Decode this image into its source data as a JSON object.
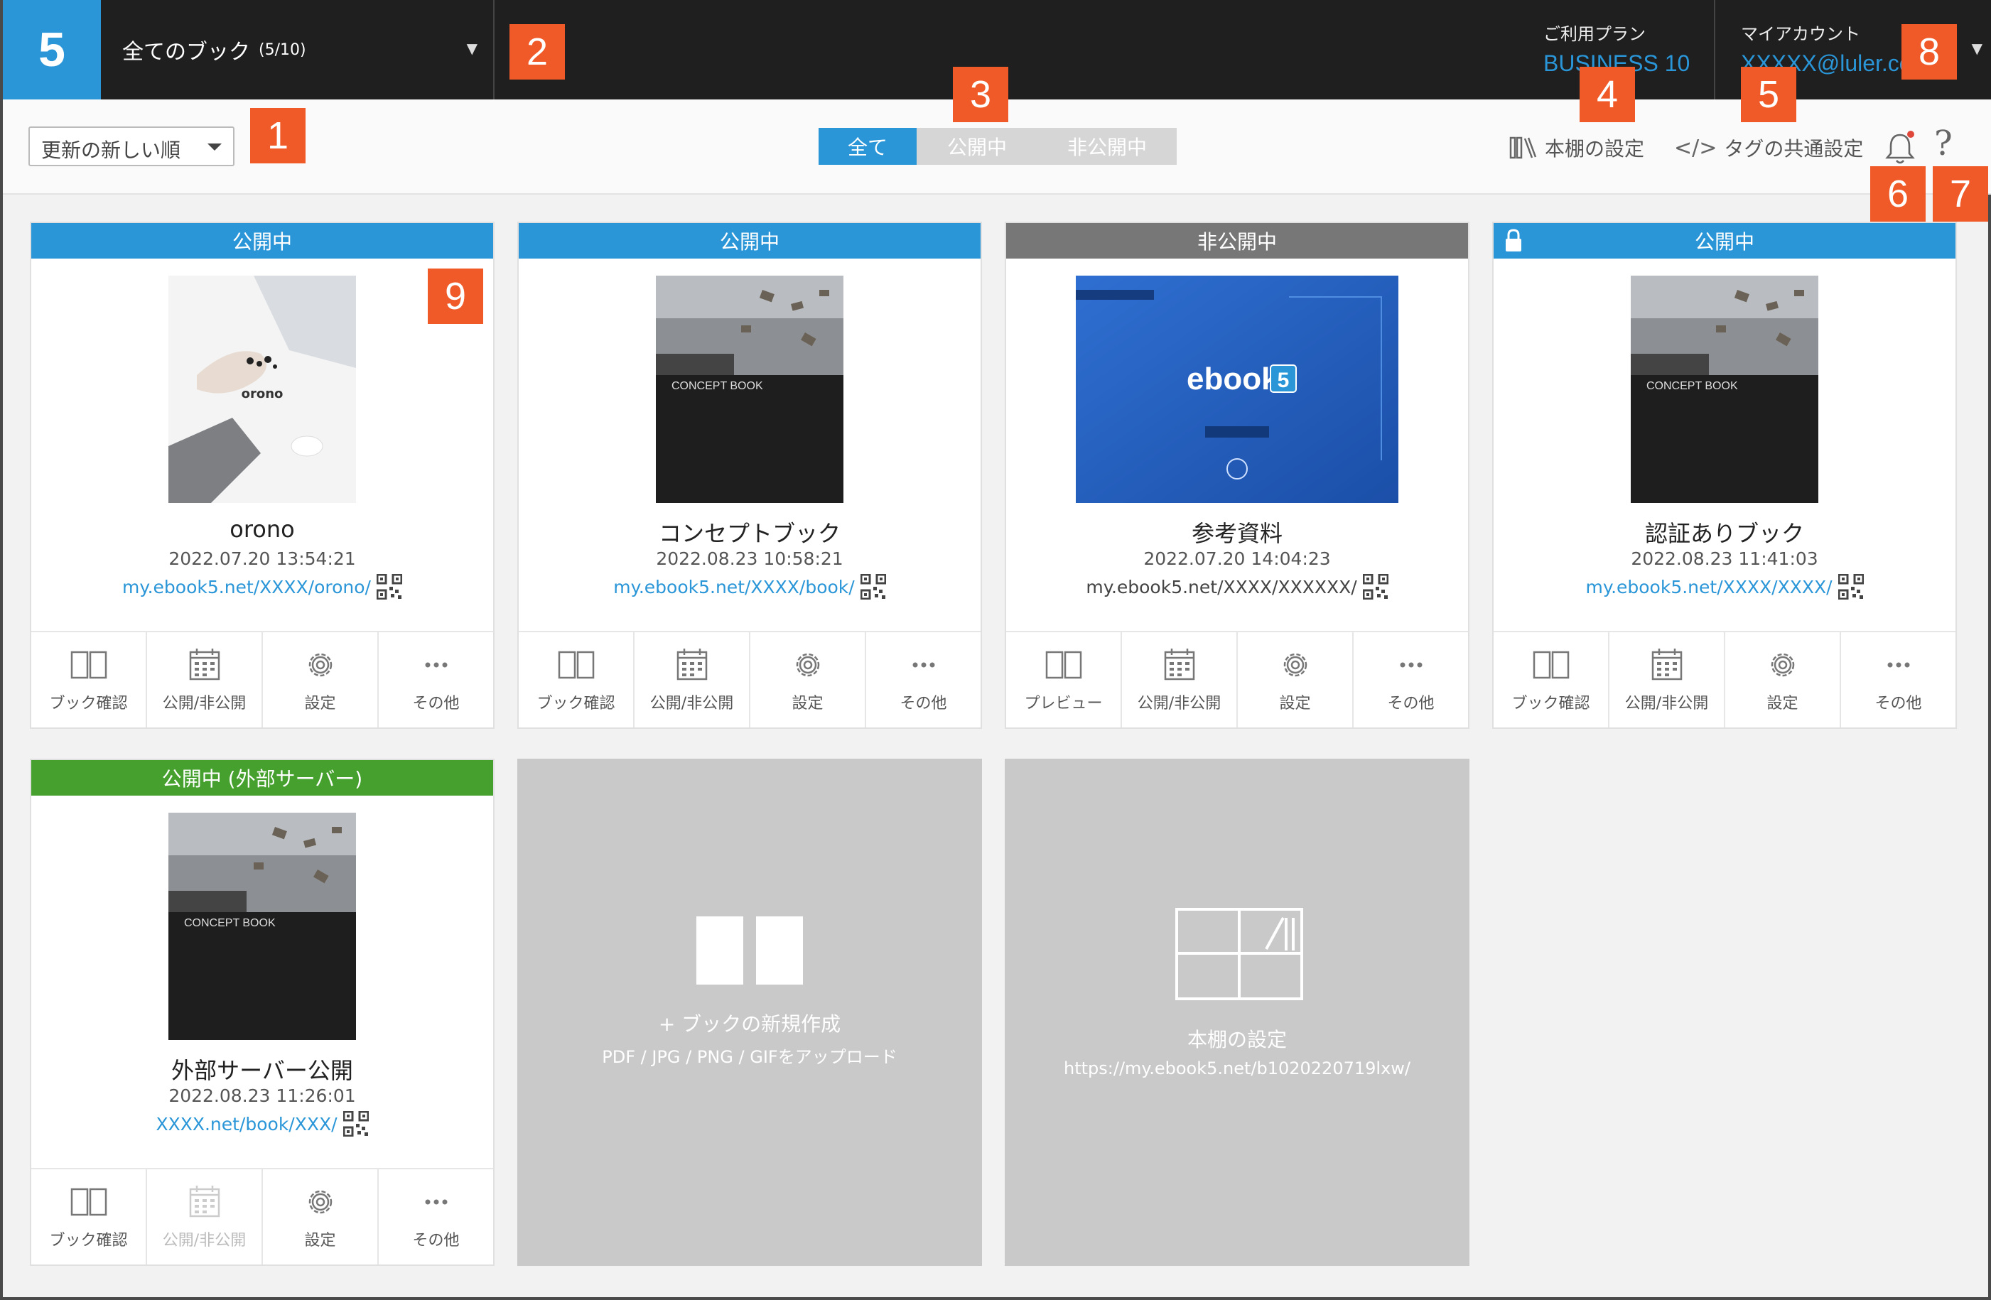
{
  "header": {
    "logo": "5",
    "book_selector": {
      "title": "全てのブック",
      "count": "(5/10)"
    },
    "plan": {
      "label": "ご利用プラン",
      "value": "BUSINESS 10"
    },
    "account": {
      "label": "マイアカウント",
      "value": "XXXXX@luler.co"
    }
  },
  "toolbar": {
    "sort": "更新の新しい順",
    "tabs": [
      "全て",
      "公開中",
      "非公開中"
    ],
    "active_tab": "全て",
    "shelf_settings": "本棚の設定",
    "tag_settings": "タグの共通設定",
    "tag_icon": "</>"
  },
  "callouts": [
    "1",
    "2",
    "3",
    "4",
    "5",
    "6",
    "7",
    "8",
    "9"
  ],
  "cards": [
    {
      "status": "公開中",
      "name": "orono",
      "date": "2022.07.20 13:54:21",
      "url": "my.ebook5.net/XXXX/orono/",
      "actions": [
        "ブック確認",
        "公開/非公開",
        "設定",
        "その他"
      ]
    },
    {
      "status": "公開中",
      "name": "コンセプトブック",
      "date": "2022.08.23 10:58:21",
      "url": "my.ebook5.net/XXXX/book/",
      "actions": [
        "ブック確認",
        "公開/非公開",
        "設定",
        "その他"
      ]
    },
    {
      "status": "非公開中",
      "name": "参考資料",
      "date": "2022.07.20 14:04:23",
      "url": "my.ebook5.net/XXXX/XXXXXX/",
      "actions": [
        "プレビュー",
        "公開/非公開",
        "設定",
        "その他"
      ]
    },
    {
      "status": "公開中",
      "name": "認証ありブック",
      "date": "2022.08.23 11:41:03",
      "url": "my.ebook5.net/XXXX/XXXX/",
      "actions": [
        "ブック確認",
        "公開/非公開",
        "設定",
        "その他"
      ]
    },
    {
      "status": "公開中 (外部サーバー)",
      "name": "外部サーバー公開",
      "date": "2022.08.23 11:26:01",
      "url": "XXXX.net/book/XXX/",
      "actions": [
        "ブック確認",
        "公開/非公開",
        "設定",
        "その他"
      ]
    }
  ],
  "cover_texts": {
    "orono": "orono",
    "concept": "CONCEPT BOOK",
    "ebook": "ebook",
    "ebook_badge": "5"
  },
  "tiles": {
    "new_book": {
      "title": "+ ブックの新規作成",
      "subtitle": "PDF / JPG / PNG / GIFをアップロード"
    },
    "shelf": {
      "title": "本棚の設定",
      "subtitle": "https://my.ebook5.net/b1020220719lxw/"
    }
  },
  "colors": {
    "accent": "#2a96d8",
    "published": "#2a96d8",
    "private": "#777777",
    "external": "#45a02d",
    "callout": "#f05a28"
  }
}
